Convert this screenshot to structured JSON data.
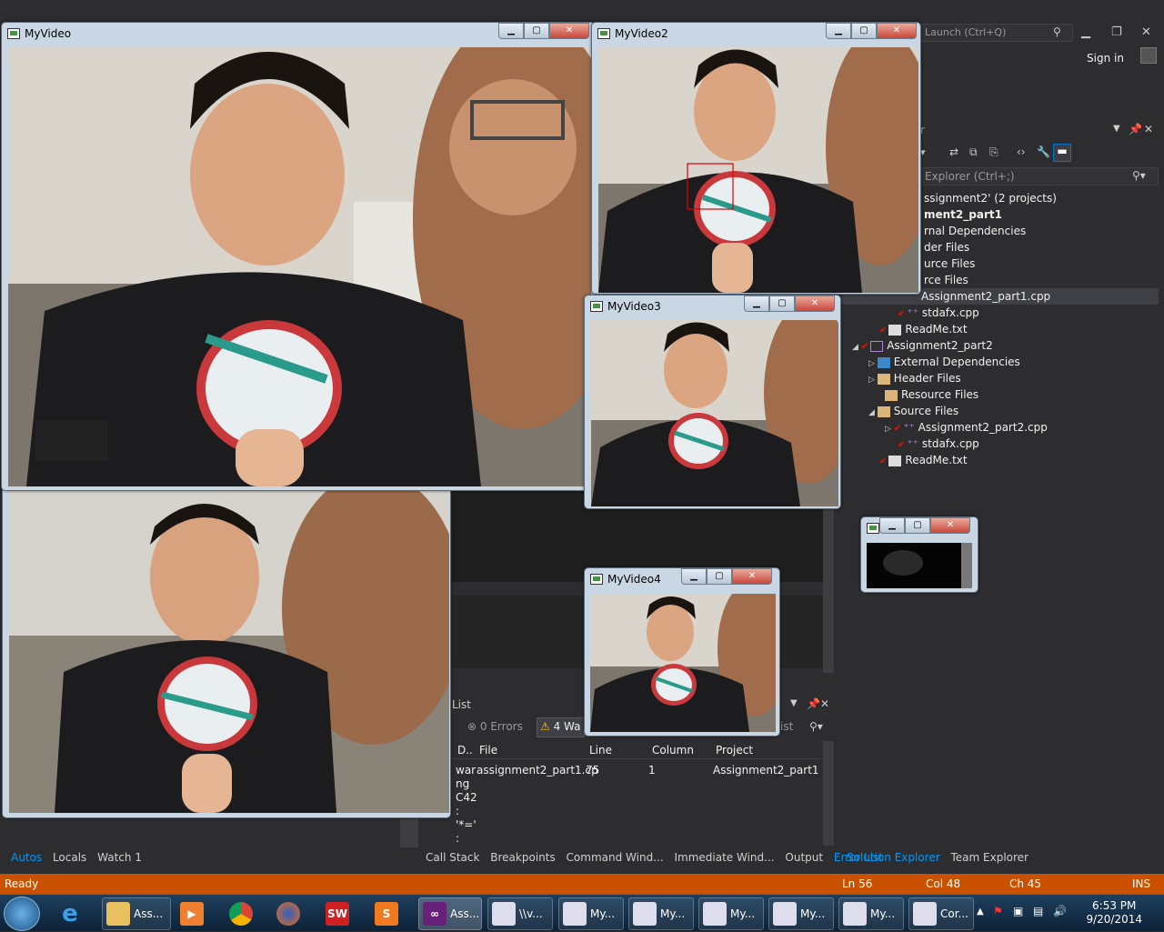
{
  "vs": {
    "quick_launch": "Launch (Ctrl+Q)",
    "sign_in": "Sign in",
    "solution_explorer": {
      "search_placeholder": "Explorer (Ctrl+;)",
      "items": [
        {
          "label": "ssignment2' (2 projects)"
        },
        {
          "label": "ment2_part1"
        },
        {
          "label": "rnal Dependencies"
        },
        {
          "label": "der Files"
        },
        {
          "label": "urce Files"
        },
        {
          "label": "rce Files"
        },
        {
          "label": "Assignment2_part1.cpp"
        },
        {
          "label": "stdafx.cpp"
        },
        {
          "label": "ReadMe.txt"
        },
        {
          "label": "Assignment2_part2"
        },
        {
          "label": "External Dependencies"
        },
        {
          "label": "Header Files"
        },
        {
          "label": "Resource Files"
        },
        {
          "label": "Source Files"
        },
        {
          "label": "Assignment2_part2.cpp"
        },
        {
          "label": "stdafx.cpp"
        },
        {
          "label": "ReadMe.txt"
        }
      ]
    },
    "error_list": {
      "title": "List",
      "errors": "0 Errors",
      "warnings": "4 Wa",
      "search_tail": "ist",
      "columns": [
        "D..",
        "File",
        "Line",
        "Column",
        "Project"
      ],
      "row": {
        "desc": [
          "war",
          "ng",
          "C42",
          ":",
          "'*='",
          ":"
        ],
        "file": "assignment2_part1.cp",
        "line": "75",
        "column": "1",
        "project": "Assignment2_part1"
      }
    },
    "bottom_tabs_left": [
      "Autos",
      "Locals",
      "Watch 1"
    ],
    "bottom_tabs_mid": [
      "Call Stack",
      "Breakpoints",
      "Command Wind...",
      "Immediate Wind...",
      "Output",
      "Error List"
    ],
    "bottom_tabs_right": [
      "Solution Explorer",
      "Team Explorer"
    ],
    "status": {
      "ready": "Ready",
      "ln": "Ln 56",
      "col": "Col 48",
      "ch": "Ch 45",
      "ins": "INS"
    }
  },
  "windows": {
    "w1": "MyVideo",
    "w2": "MyVideo2",
    "w3": "MyVideo3",
    "w4": "MyVideo4",
    "btn_min": "▁",
    "btn_max": "▢",
    "btn_close": "✕"
  },
  "taskbar": {
    "buttons": [
      {
        "label": "Ass..."
      },
      {
        "label": "Ass..."
      },
      {
        "label": "\\\\v..."
      },
      {
        "label": "My..."
      },
      {
        "label": "My..."
      },
      {
        "label": "My..."
      },
      {
        "label": "My..."
      },
      {
        "label": "My..."
      },
      {
        "label": "Cor..."
      }
    ],
    "time": "6:53 PM",
    "date": "9/20/2014"
  },
  "colors": {
    "accent": "#0097fb",
    "status_bar": "#ca5100",
    "vs_bg": "#2d2d30"
  }
}
